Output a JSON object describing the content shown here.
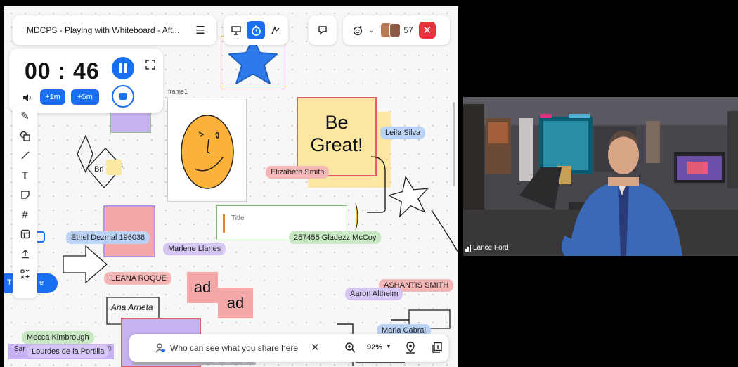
{
  "board": {
    "title": "MDCPS - Playing with Whiteboard - Aft...",
    "participant_count": "57",
    "zoom": "92%",
    "share_text": "Who can see what you share here"
  },
  "timer": {
    "display": "00 : 46",
    "add_1m": "+1m",
    "add_5m": "+5m"
  },
  "canvas": {
    "frame_label": "frame1",
    "sticky_be_great_line1": "Be",
    "sticky_be_great_line2": "Great!",
    "title_card": "Title",
    "bri_text": "Bri",
    "ad_1": "ad",
    "ad_2": "ad",
    "ana_text": "Ana Arrieta",
    "cut_text_sar": "Sar",
    "cut_text_e": "e",
    "cut_text_t": "T",
    "cut_text_num": "118500"
  },
  "tags": {
    "leila": "Leila Silva",
    "elizabeth": "Elizabeth Smith",
    "ethel": "Ethel Dezmal 196036",
    "marlene": "Marlene Llanes",
    "gladezz": "257455 Gladezz McCoy",
    "ileana": "ILEANA ROQUE",
    "ashantis": "ASHANTIS SMITH",
    "aaron": "Aaron Altheim",
    "maria": "Maria Cabral",
    "mecca": "Mecca Kimbrough",
    "lourdes": "Lourdes de la Portilla"
  },
  "video": {
    "name": "Lance Ford"
  },
  "colors": {
    "accent": "#1a6ff0",
    "close_red": "#e8343c",
    "sticky_pink": "#f4a7a7",
    "sticky_yellow": "#fbe7a1",
    "star_blue": "#2d7bea",
    "face_orange": "#fbb13a",
    "purple": "#c7b3f2"
  }
}
